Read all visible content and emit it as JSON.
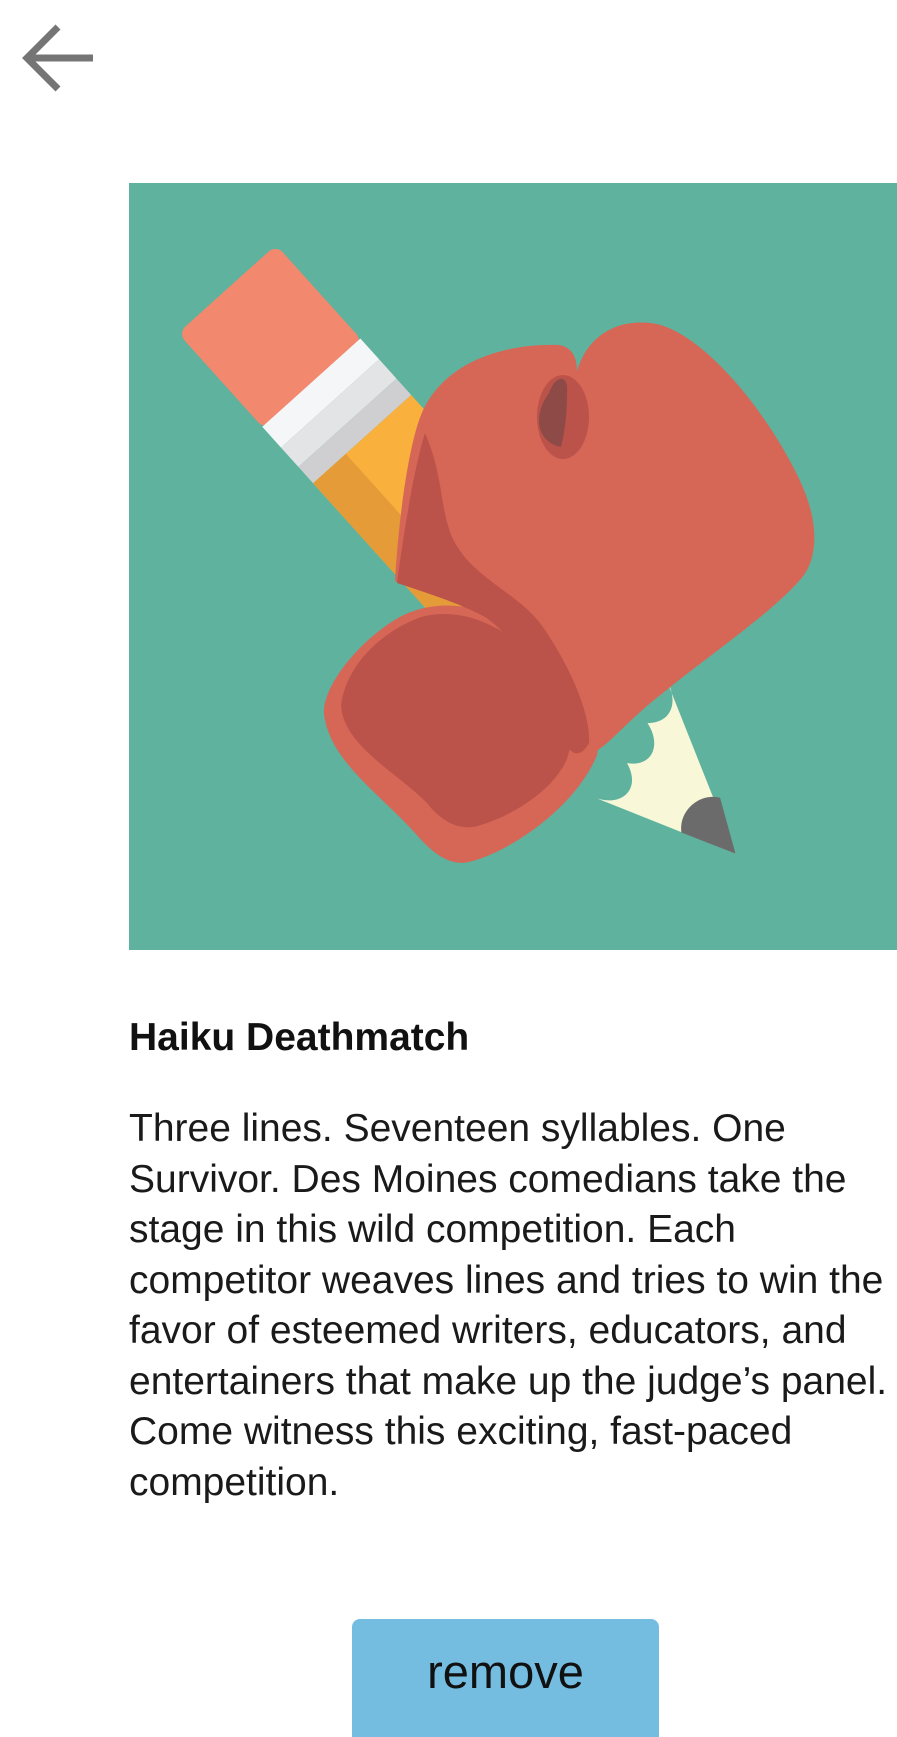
{
  "header": {
    "back_icon": "arrow-left-icon"
  },
  "event": {
    "image_icon": "boxing-glove-and-pencil-illustration",
    "title": "Haiku Deathmatch",
    "description": "Three lines. Seventeen syllables. One Survivor. Des Moines comedians take the stage in this wild competition. Each competitor weaves lines and tries to win the favor of esteemed writers, educators, and entertainers that make up the judge’s panel. Come witness this exciting, fast-paced competition."
  },
  "actions": {
    "remove_label": "remove"
  },
  "colors": {
    "hero_background": "#5fb29e",
    "button_background": "#74bde0",
    "icon_gray": "#757575",
    "glove": "#d66757",
    "glove_shadow": "#bc534a",
    "pencil_eraser": "#f2886d",
    "pencil_body": "#f9b03c",
    "pencil_tip": "#f8f8d8"
  }
}
